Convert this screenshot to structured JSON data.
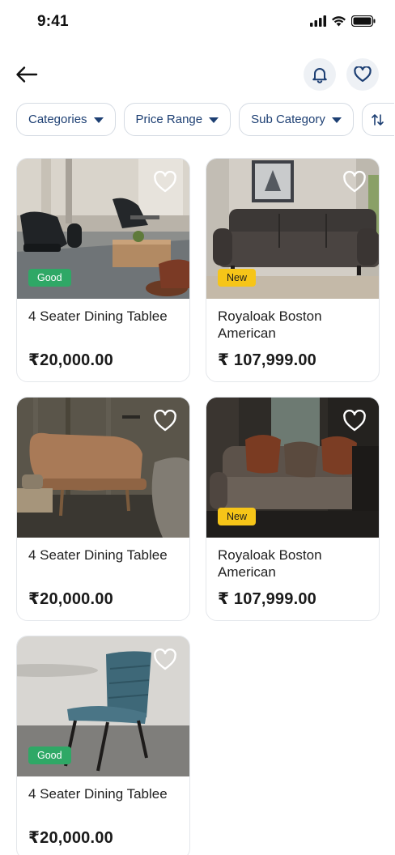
{
  "status": {
    "time": "9:41"
  },
  "header": {
    "back_icon": "arrow-left-icon",
    "notification_icon": "bell-icon",
    "wishlist_icon": "heart-icon"
  },
  "filters": [
    {
      "label": "Categories"
    },
    {
      "label": "Price Range"
    },
    {
      "label": "Sub Category"
    }
  ],
  "products": [
    {
      "title": "4 Seater Dining Tablee",
      "price": "₹20,000.00",
      "badge": "Good"
    },
    {
      "title": "Royaloak Boston American",
      "price": "₹ 107,999.00",
      "badge": "New"
    },
    {
      "title": "4 Seater Dining Tablee",
      "price": "₹20,000.00",
      "badge": ""
    },
    {
      "title": "Royaloak Boston American",
      "price": "₹ 107,999.00",
      "badge": "New"
    },
    {
      "title": "4 Seater Dining Tablee",
      "price": "₹20,000.00",
      "badge": "Good"
    }
  ],
  "colors": {
    "primary": "#1d3f73",
    "badge_good": "#2fa866",
    "badge_new": "#f6c518"
  }
}
